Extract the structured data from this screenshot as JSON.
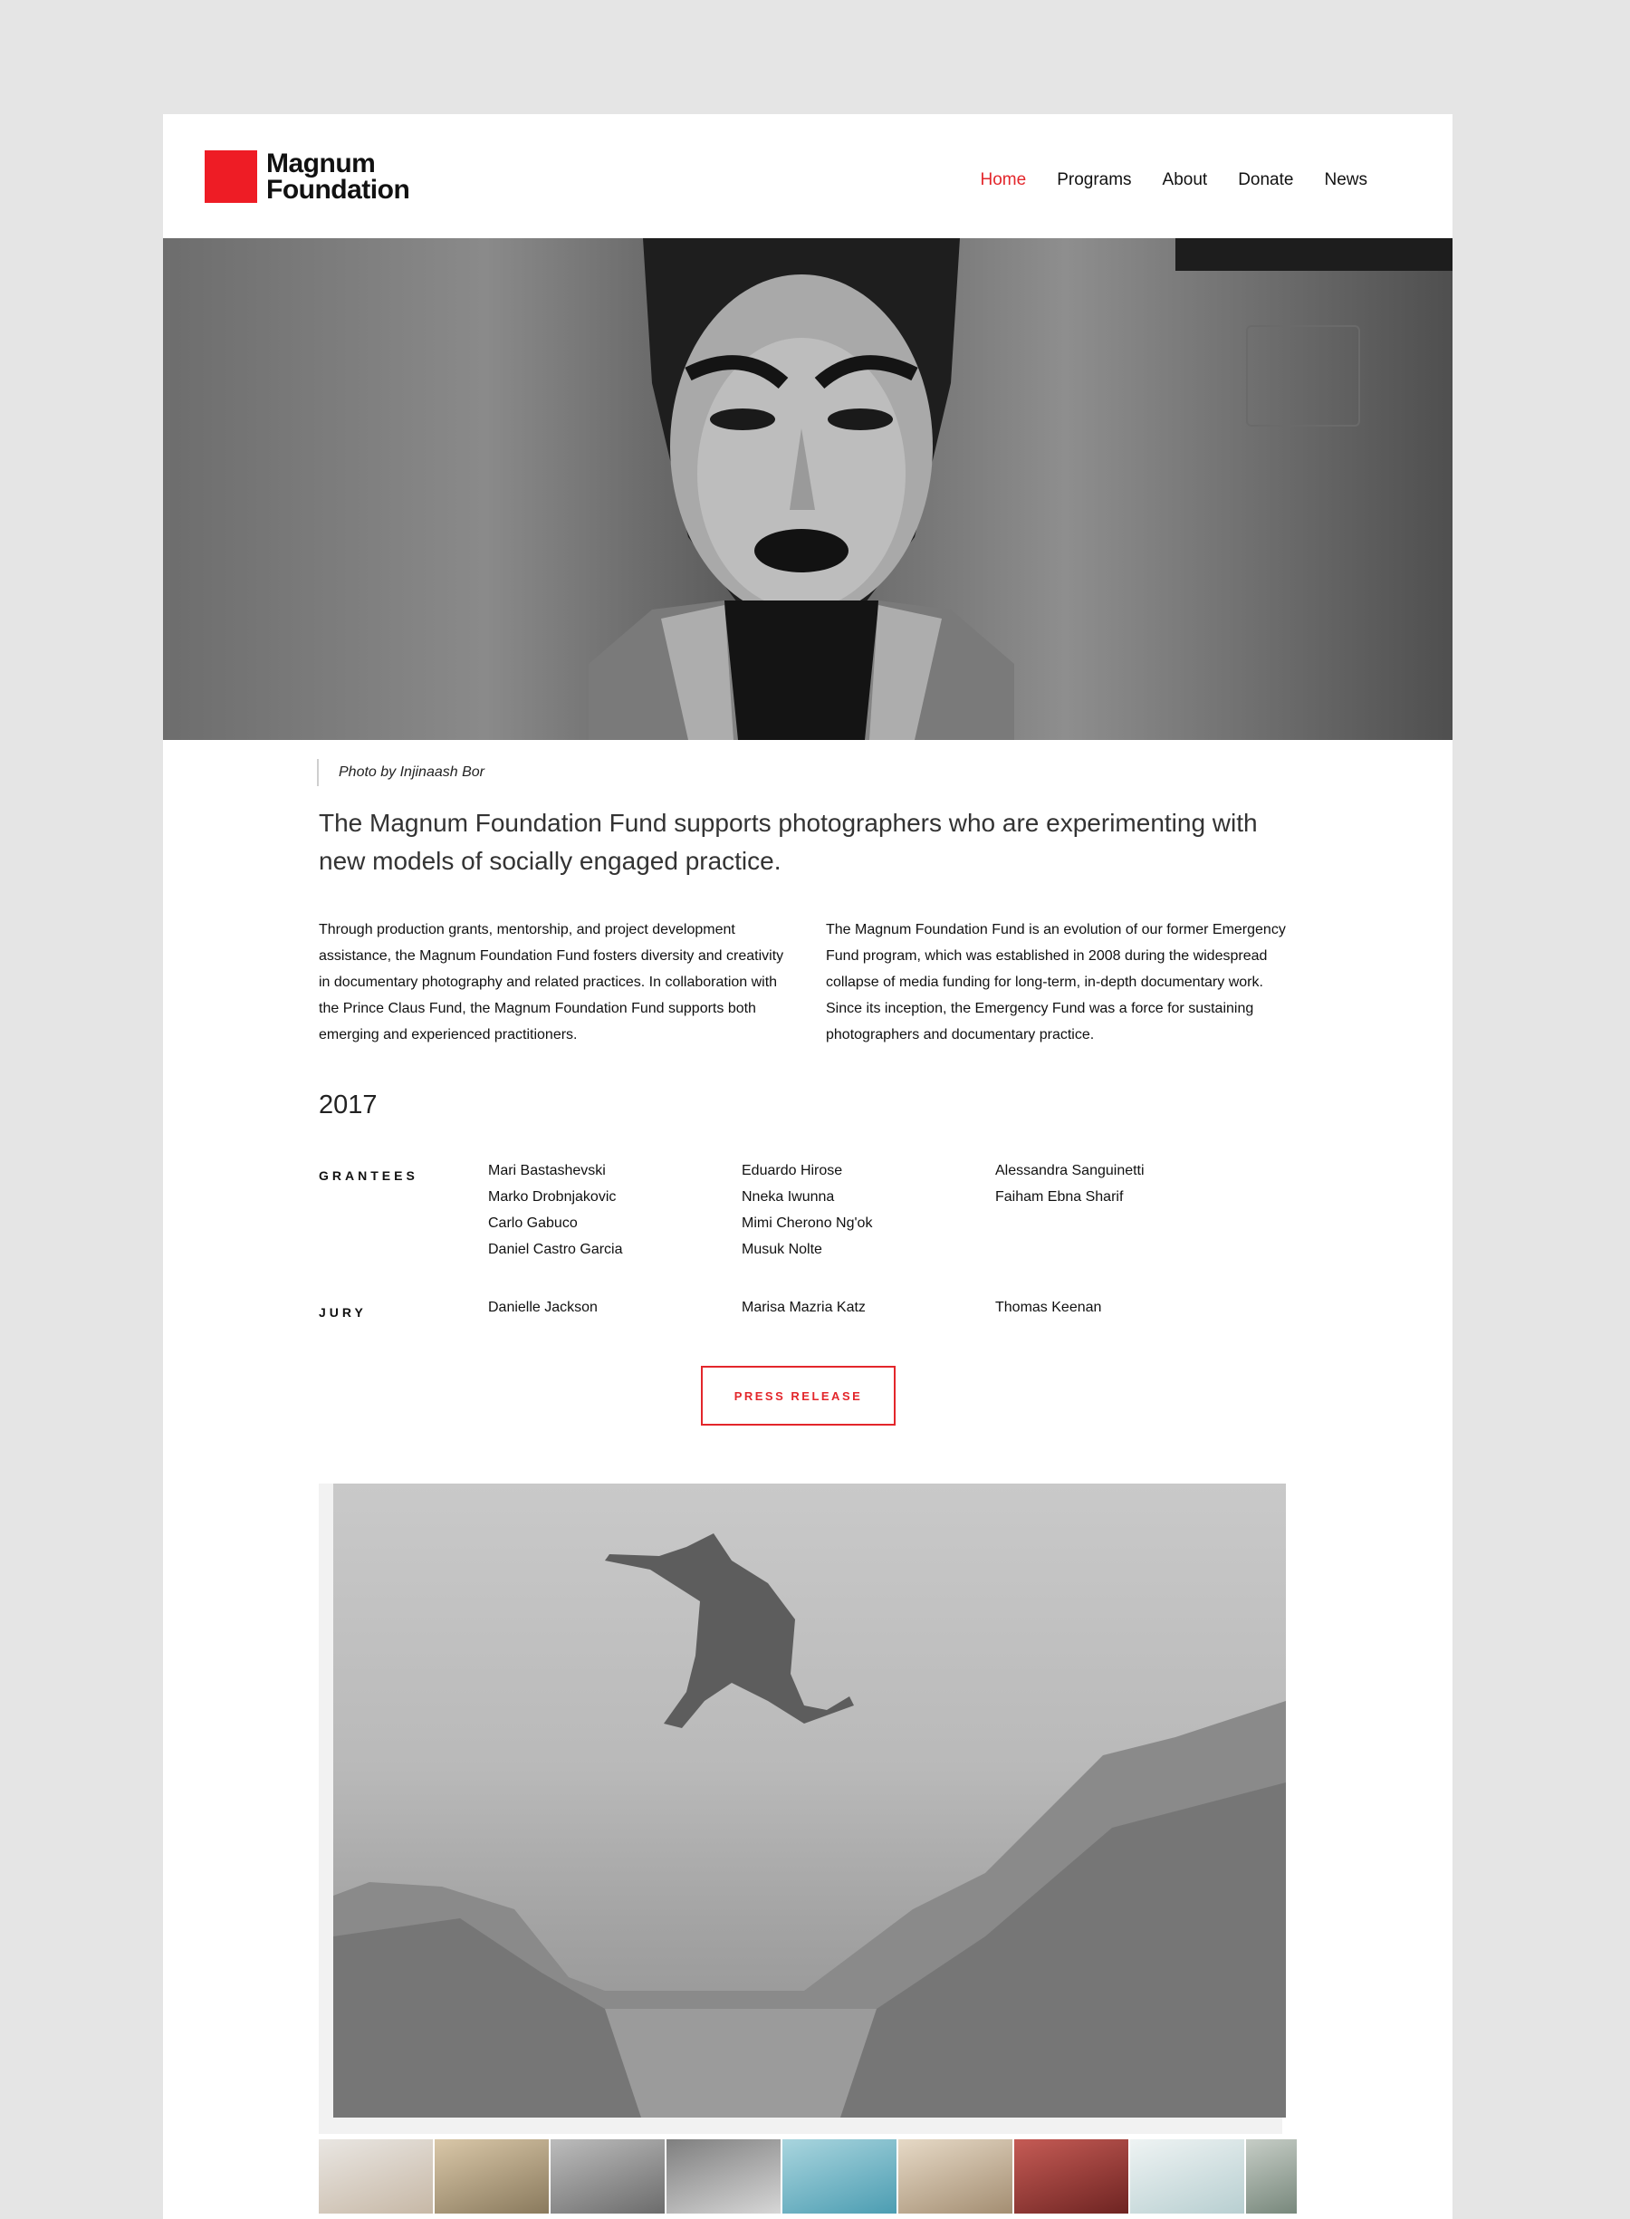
{
  "brand": {
    "line1": "Magnum",
    "line2": "Foundation",
    "color": "#ee1c25"
  },
  "nav": {
    "items": [
      "Home",
      "Programs",
      "About",
      "Donate",
      "News"
    ],
    "active": "Home",
    "active_color": "#e3262b"
  },
  "hero": {
    "caption": "Photo by Injinaash Bor"
  },
  "intro": "The Magnum Foundation Fund supports photographers who are experimenting with new models of socially engaged practice.",
  "body": {
    "left": "Through production grants, mentorship, and project development assistance, the Magnum Foundation Fund fosters diversity and creativity in documentary photography and related practices. In collaboration with the Prince Claus Fund, the Magnum Foundation Fund supports both emerging and experienced practitioners.",
    "right": "The Magnum Foundation Fund is an evolution of our former Emergency Fund program, which was established in 2008 during the widespread collapse of media funding for long-term, in-depth documentary work. Since its inception, the Emergency Fund was a force for sustaining photographers and documentary practice."
  },
  "year": "2017",
  "grantees": {
    "label": "GRANTEES",
    "col1": [
      "Mari Bastashevski",
      "Marko Drobnjakovic",
      "Carlo Gabuco",
      "Daniel Castro Garcia"
    ],
    "col2": [
      "Eduardo Hirose",
      "Nneka Iwunna",
      "Mimi Cherono Ng'ok",
      "Musuk Nolte"
    ],
    "col3": [
      "Alessandra Sanguinetti",
      "Faiham Ebna Sharif"
    ]
  },
  "jury": {
    "label": "JURY",
    "col1": "Danielle Jackson",
    "col2": "Marisa Mazria Katz",
    "col3": "Thomas Keenan"
  },
  "press_button": "PRESS RELEASE",
  "thumbnails": [
    {
      "colors": [
        "#e9e6e2",
        "#c7b8a6"
      ]
    },
    {
      "colors": [
        "#d9c7a8",
        "#8a7a5d"
      ]
    },
    {
      "colors": [
        "#bcbcbc",
        "#6c6c6c"
      ]
    },
    {
      "colors": [
        "#7f7f7f",
        "#d6d6d6"
      ]
    },
    {
      "colors": [
        "#a9d5de",
        "#4c9db2"
      ]
    },
    {
      "colors": [
        "#e6d9c6",
        "#a48e72"
      ]
    },
    {
      "colors": [
        "#c55b55",
        "#6e2422"
      ]
    },
    {
      "colors": [
        "#eef3f3",
        "#b8cfd1"
      ]
    },
    {
      "colors": [
        "#c6cdc6",
        "#78887c"
      ]
    }
  ]
}
